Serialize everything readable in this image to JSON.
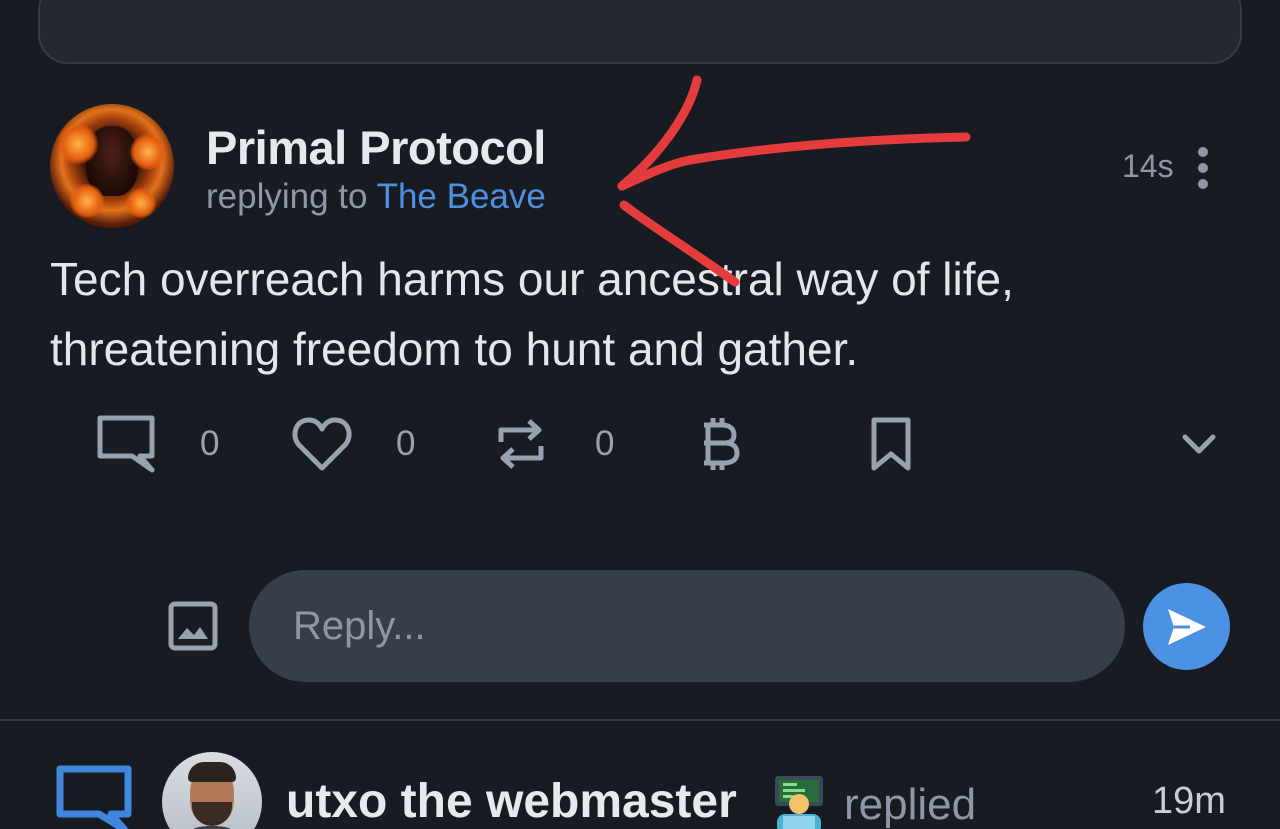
{
  "post": {
    "author": "Primal Protocol",
    "reply_prefix": "replying to",
    "reply_target": "The Beave",
    "timestamp": "14s",
    "text": "Tech overreach harms our ancestral way of life, threatening freedom to hunt and gather.",
    "actions": {
      "reply_count": "0",
      "like_count": "0",
      "repost_count": "0"
    }
  },
  "reply_box": {
    "placeholder": "Reply..."
  },
  "notification": {
    "name": "utxo the webmaster",
    "emoji": "technologist-emoji",
    "action": "replied",
    "time": "19m"
  },
  "colors": {
    "background": "#181b22",
    "accent": "#4c90df",
    "annotation": "#e43c3c"
  },
  "icons": [
    "more-icon",
    "comment-icon",
    "heart-icon",
    "repost-icon",
    "bitcoin-icon",
    "bookmark-icon",
    "chevron-down-icon",
    "image-icon",
    "send-icon"
  ]
}
